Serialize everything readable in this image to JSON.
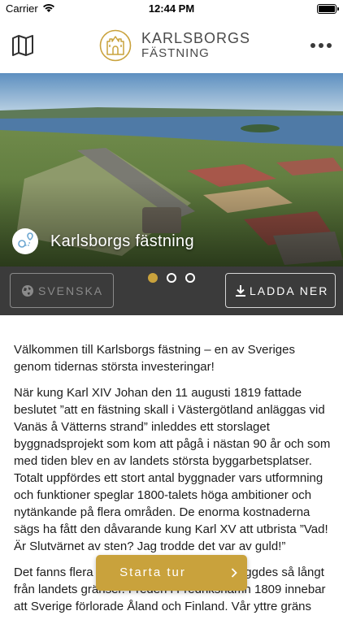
{
  "status_bar": {
    "carrier": "Carrier",
    "time": "12:44 PM",
    "icons": [
      "wifi-icon",
      "battery-icon"
    ]
  },
  "header": {
    "brand_line1": "KARLSBORGS",
    "brand_line2": "FÄSTNING",
    "icons": [
      "map-icon",
      "fortress-logo-icon",
      "more-icon"
    ],
    "accent_color": "#c9a23c"
  },
  "hero": {
    "title": "Karlsborgs fästning",
    "badge_icon": "location-route-icon"
  },
  "controls": {
    "language_label": "SVENSKA",
    "language_icon": "globe-icon",
    "download_label": "LADDA NER",
    "download_icon": "download-icon",
    "carousel": {
      "pages": 3,
      "active_index": 0
    }
  },
  "article": {
    "paragraphs": [
      "Välkommen till Karlsborgs fästning – en av Sveriges genom tidernas största investeringar!",
      "När kung Karl XIV Johan den 11 augusti 1819 fattade beslutet ”att en fästning skall i Västergötland anläggas vid Vanäs å Vätterns strand” inleddes ett storslaget byggnadsprojekt som kom att pågå i nästan 90 år och som med tiden blev en av landets största byggarbetsplatser. Totalt uppfördes ett stort antal byggnader vars utformning och funktioner speglar 1800-talets höga ambitioner och nytänkande på flera områden. De enorma kostnaderna sägs ha fått den dåvarande kung Karl XV att utbrista ”Vad! Är Slutvärnet av sten? Jag trodde det var av guld!”",
      "Det fanns flera orsaker till att fästningen byggdes så långt från landets gränser. Freden i Fredrikshamn 1809 innebar att Sverige förlorade Åland och Finland. Vår yttre gräns"
    ]
  },
  "cta": {
    "label": "Starta tur",
    "icon": "chevron-right-icon"
  }
}
